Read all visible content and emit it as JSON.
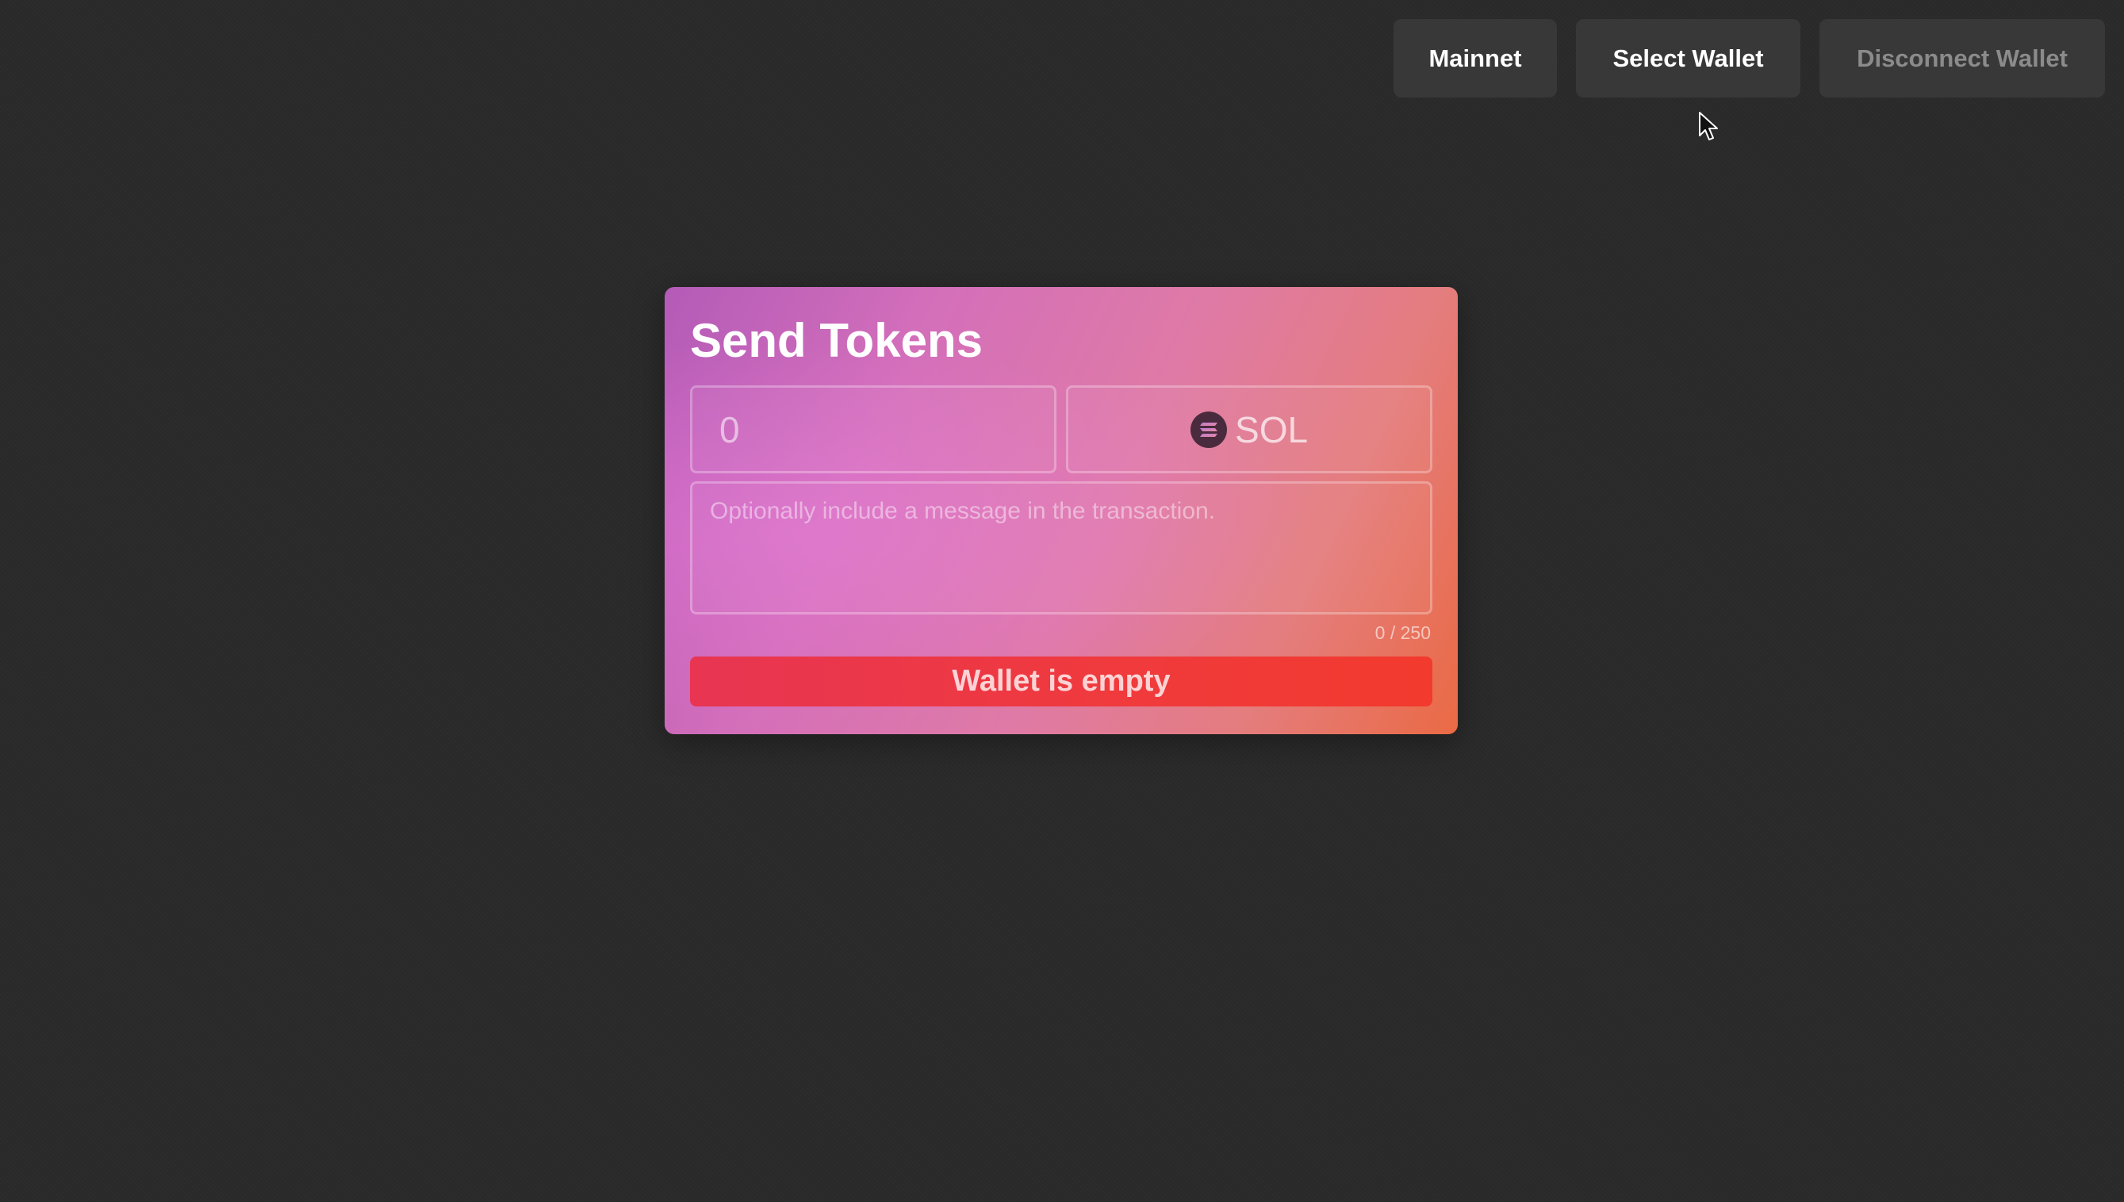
{
  "nav": {
    "network_label": "Mainnet",
    "select_wallet_label": "Select Wallet",
    "disconnect_wallet_label": "Disconnect Wallet"
  },
  "card": {
    "title": "Send Tokens",
    "amount": {
      "placeholder": "0"
    },
    "token": {
      "label": "SOL",
      "icon": "solana-icon"
    },
    "message": {
      "placeholder": "Optionally include a message in the transaction."
    },
    "counter": "0 / 250",
    "submit_label": "Wallet is empty"
  },
  "colors": {
    "background": "#2a2a2a",
    "nav_button": "#383838",
    "card_gradient_start": "#b45bb8",
    "card_gradient_end": "#ea6a44",
    "submit_button": "#f03a3c"
  }
}
